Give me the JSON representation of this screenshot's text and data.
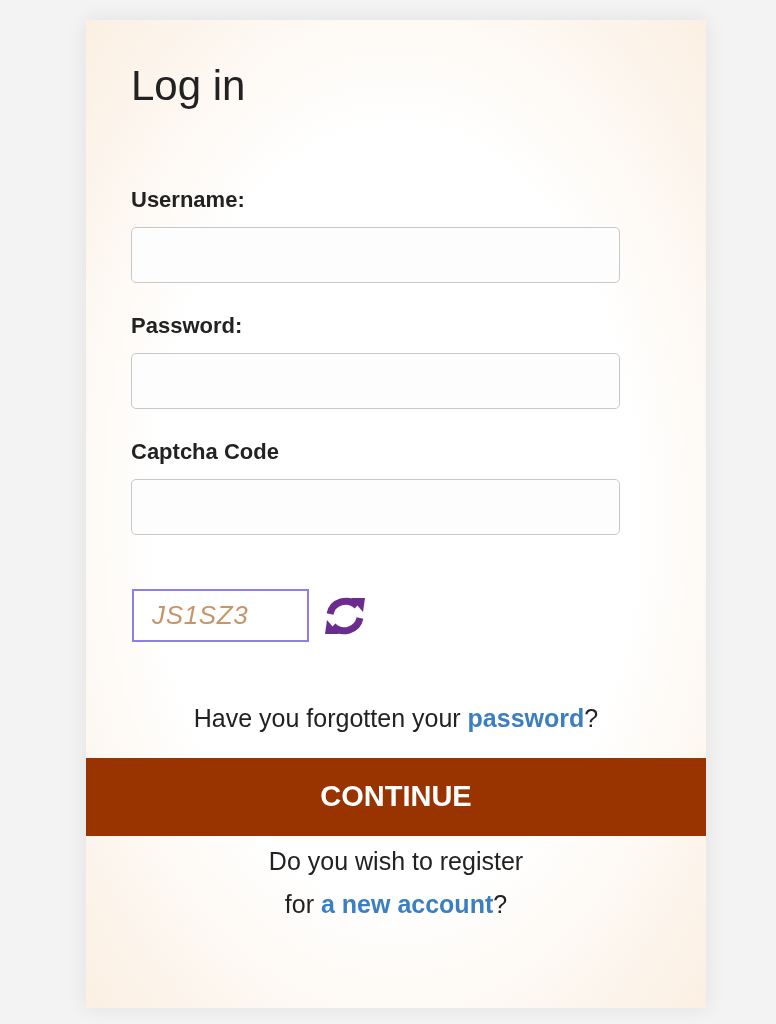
{
  "title": "Log in",
  "fields": [
    {
      "label": "Username:"
    },
    {
      "label": "Password:"
    },
    {
      "label": "Captcha Code"
    }
  ],
  "captcha": {
    "code": "JS1SZ3"
  },
  "forgot": {
    "before": "Have you forgotten your ",
    "link": "password",
    "after": "?"
  },
  "submit": "CONTINUE",
  "register": {
    "line1": "Do you wish to register",
    "before": "for ",
    "link": "a new account",
    "after": "?"
  }
}
